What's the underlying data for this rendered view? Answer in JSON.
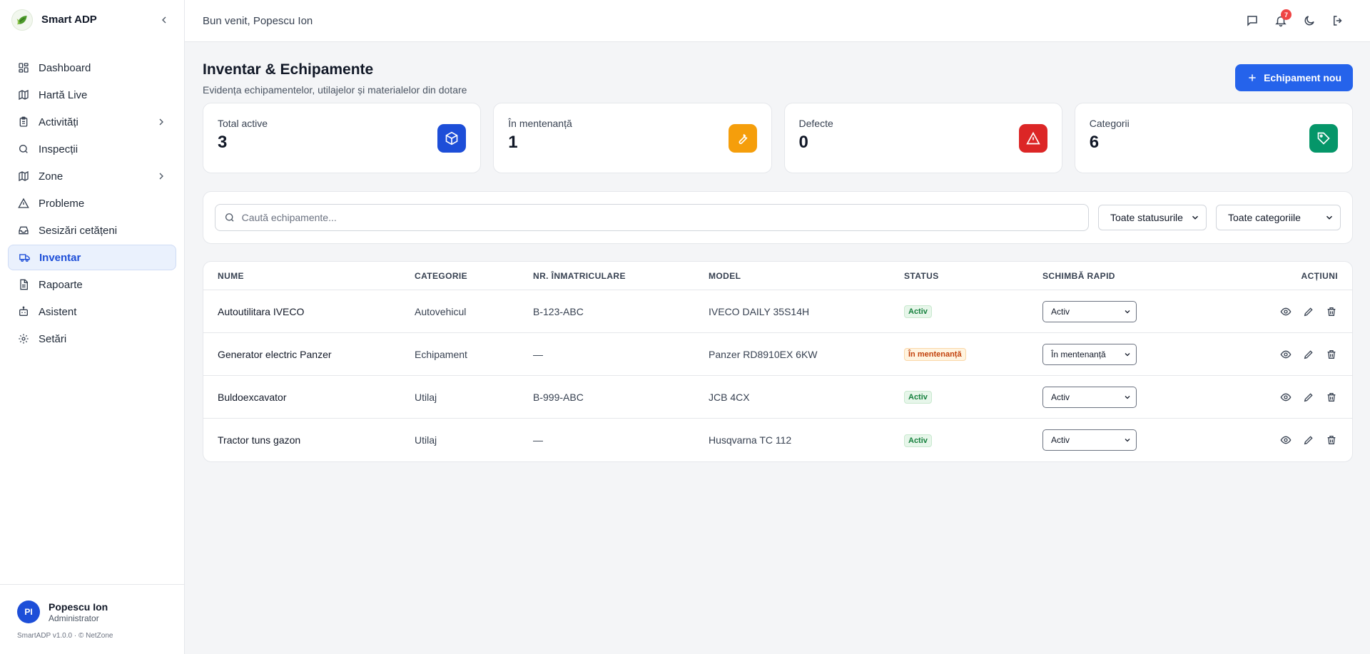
{
  "app": {
    "name": "Smart ADP",
    "version_text": "SmartADP v1.0.0 · © NetZone"
  },
  "sidebar": {
    "items": [
      {
        "label": "Dashboard",
        "icon": "grid-icon",
        "active": false,
        "expandable": false
      },
      {
        "label": "Hartă Live",
        "icon": "map-icon",
        "active": false,
        "expandable": false
      },
      {
        "label": "Activități",
        "icon": "clipboard-icon",
        "active": false,
        "expandable": true
      },
      {
        "label": "Inspecții",
        "icon": "search-icon",
        "active": false,
        "expandable": false
      },
      {
        "label": "Zone",
        "icon": "map-icon",
        "active": false,
        "expandable": true
      },
      {
        "label": "Probleme",
        "icon": "warning-icon",
        "active": false,
        "expandable": false
      },
      {
        "label": "Sesizări cetățeni",
        "icon": "inbox-icon",
        "active": false,
        "expandable": false
      },
      {
        "label": "Inventar",
        "icon": "truck-icon",
        "active": true,
        "expandable": false
      },
      {
        "label": "Rapoarte",
        "icon": "report-icon",
        "active": false,
        "expandable": false
      },
      {
        "label": "Asistent",
        "icon": "robot-icon",
        "active": false,
        "expandable": false
      },
      {
        "label": "Setări",
        "icon": "gear-icon",
        "active": false,
        "expandable": false
      }
    ]
  },
  "user": {
    "initials": "PI",
    "name": "Popescu Ion",
    "role": "Administrator"
  },
  "topbar": {
    "welcome": "Bun venit, Popescu Ion",
    "notifications_count": "7"
  },
  "page": {
    "title": "Inventar & Echipamente",
    "subtitle": "Evidența echipamentelor, utilajelor și materialelor din dotare",
    "new_button": "Echipament nou"
  },
  "stats": [
    {
      "label": "Total active",
      "value": "3",
      "color": "#1d4ed8",
      "icon": "box-icon"
    },
    {
      "label": "În mentenanță",
      "value": "1",
      "color": "#f59e0b",
      "icon": "wrench-icon"
    },
    {
      "label": "Defecte",
      "value": "0",
      "color": "#dc2626",
      "icon": "warning-icon"
    },
    {
      "label": "Categorii",
      "value": "6",
      "color": "#059669",
      "icon": "tag-icon"
    }
  ],
  "filters": {
    "search_placeholder": "Caută echipamente...",
    "status_select": "Toate statusurile",
    "category_select": "Toate categoriile"
  },
  "table": {
    "headers": [
      "NUME",
      "CATEGORIE",
      "NR. ÎNMATRICULARE",
      "MODEL",
      "STATUS",
      "SCHIMBĂ RAPID",
      "ACȚIUNI"
    ],
    "rows": [
      {
        "name": "Autoutilitara IVECO",
        "category": "Autovehicul",
        "plate": "B-123-ABC",
        "model": "IVECO DAILY 35S14H",
        "status": "Activ",
        "status_kind": "ok",
        "quick": "Activ"
      },
      {
        "name": "Generator electric Panzer",
        "category": "Echipament",
        "plate": "—",
        "model": "Panzer RD8910EX 6KW",
        "status": "În mentenanță",
        "status_kind": "warn",
        "quick": "În mentenanță"
      },
      {
        "name": "Buldoexcavator",
        "category": "Utilaj",
        "plate": "B-999-ABC",
        "model": "JCB 4CX",
        "status": "Activ",
        "status_kind": "ok",
        "quick": "Activ"
      },
      {
        "name": "Tractor tuns gazon",
        "category": "Utilaj",
        "plate": "—",
        "model": "Husqvarna TC 112",
        "status": "Activ",
        "status_kind": "ok",
        "quick": "Activ"
      }
    ]
  }
}
